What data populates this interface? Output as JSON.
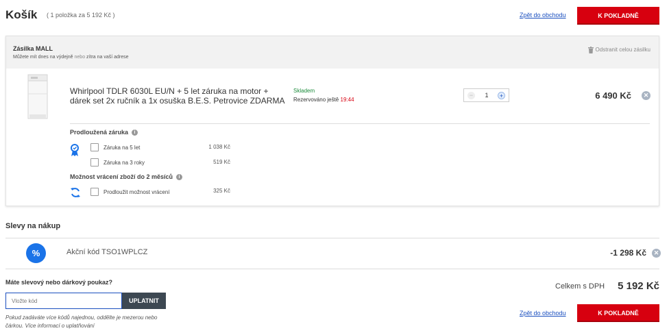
{
  "header": {
    "title": "Košík",
    "subtitle": "( 1 položka za 5 192 Kč )",
    "back_link": "Zpět do obchodu",
    "checkout_label": "K POKLADNĚ"
  },
  "package": {
    "title": "Zásilka MALL",
    "delivery_prefix": "Můžete mít dnes na výdejně",
    "delivery_or": "nebo",
    "delivery_suffix": "zítra na vaší adrese",
    "remove_all_label": "Odstranit celou zásilku",
    "product": {
      "name": "Whirlpool TDLR 6030L EU/N + 5 let záruka na motor + dárek set 2x ručník a 1x osuška B.E.S. Petrovice ZDARMA",
      "stock": "Skladem",
      "reserved_prefix": "Rezervováno ještě",
      "reserved_time": "19:44",
      "quantity": "1",
      "price": "6 490 Kč"
    },
    "warranty": {
      "title": "Prodloužená záruka",
      "options": [
        {
          "label": "Záruka na 5 let",
          "price": "1 038 Kč",
          "checked": false
        },
        {
          "label": "Záruka na 3 roky",
          "price": "519 Kč",
          "checked": false
        }
      ]
    },
    "returns": {
      "title": "Možnost vrácení zboží do 2 měsíců",
      "options": [
        {
          "label": "Prodloužit možnost vrácení",
          "price": "325 Kč",
          "checked": false
        }
      ]
    }
  },
  "discounts": {
    "title": "Slevy na nákup",
    "code_label": "Akční kód TSO1WPLCZ",
    "code_amount": "-1 298 Kč"
  },
  "voucher": {
    "title": "Máte slevový nebo dárkový poukaz?",
    "placeholder": "Vložte kód",
    "apply_label": "UPLATNIT",
    "note": "Pokud zadáváte více kódů najednou, oddělte je mezerou nebo čárkou. Více informací o uplatňování"
  },
  "summary": {
    "total_label": "Celkem s DPH",
    "total_value": "5 192 Kč",
    "back_link": "Zpět do obchodu",
    "checkout_label": "K POKLADNĚ"
  },
  "colors": {
    "accent_red": "#d7000f",
    "link_blue": "#1a4fbf",
    "stock_green": "#1a8a3a",
    "discount_blue": "#1a73e8"
  }
}
